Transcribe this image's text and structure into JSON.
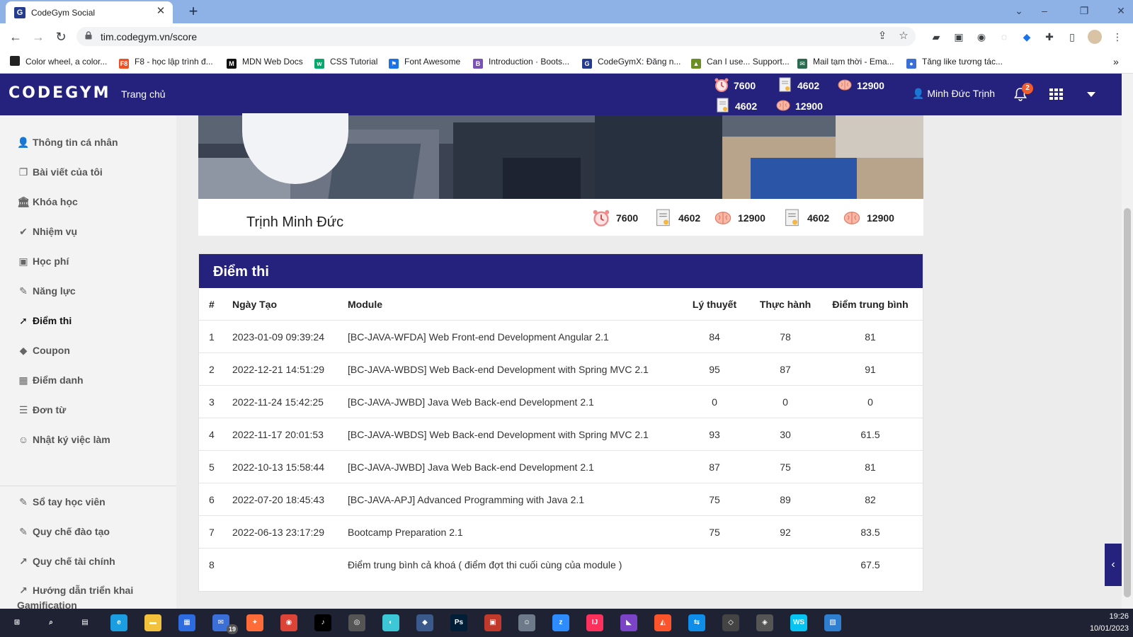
{
  "browser": {
    "tab_title": "CodeGym Social",
    "tab_favicon": "G",
    "url": "tim.codegym.vn/score",
    "bookmarks": [
      {
        "label": "Color wheel, a color...",
        "icon": "color-wheel-icon",
        "color": "#222222"
      },
      {
        "label": "F8 - học lập trình đ...",
        "icon": "f8-icon",
        "color": "#f05123"
      },
      {
        "label": "MDN Web Docs",
        "icon": "mdn-icon",
        "color": "#111111"
      },
      {
        "label": "CSS Tutorial",
        "icon": "w3schools-icon",
        "color": "#04aa6d"
      },
      {
        "label": "Font Awesome",
        "icon": "flag-icon",
        "color": "#1a73e8"
      },
      {
        "label": "Introduction · Boots...",
        "icon": "bootstrap-icon",
        "color": "#7952b3"
      },
      {
        "label": "CodeGymX: Đăng n...",
        "icon": "codegym-icon",
        "color": "#243b8e"
      },
      {
        "label": "Can I use... Support...",
        "icon": "caniuse-icon",
        "color": "#6b8e23"
      },
      {
        "label": "Mail tạm thời - Ema...",
        "icon": "mail-icon",
        "color": "#2a6b4f"
      },
      {
        "label": "Tăng like tương tác...",
        "icon": "like-icon",
        "color": "#3b6fd8"
      }
    ]
  },
  "header": {
    "logo": "CODEGYM",
    "home": "Trang chủ",
    "stats_row1": [
      "7600",
      "4602",
      "12900"
    ],
    "stats_row2": [
      "4602",
      "12900"
    ],
    "user": "Minh Đức Trịnh",
    "notification_count": "2"
  },
  "sidebar": {
    "items": [
      {
        "label": "Thông tin cá nhân",
        "icon": "user-icon",
        "glyph": "👤"
      },
      {
        "label": "Bài viết của tôi",
        "icon": "copy-icon",
        "glyph": "❐"
      },
      {
        "label": "Khóa học",
        "icon": "institution-icon",
        "glyph": "🏛"
      },
      {
        "label": "Nhiệm vụ",
        "icon": "check-icon",
        "glyph": "✔"
      },
      {
        "label": "Học phí",
        "icon": "money-icon",
        "glyph": "▣"
      },
      {
        "label": "Năng lực",
        "icon": "magic-wand-icon",
        "glyph": "✎"
      },
      {
        "label": "Điểm thi",
        "icon": "rocket-icon",
        "glyph": "➚"
      },
      {
        "label": "Coupon",
        "icon": "tag-icon",
        "glyph": "◆"
      },
      {
        "label": "Điểm danh",
        "icon": "calendar-icon",
        "glyph": "▦"
      },
      {
        "label": "Đơn từ",
        "icon": "file-icon",
        "glyph": "☰"
      },
      {
        "label": "Nhật ký việc làm",
        "icon": "handshake-icon",
        "glyph": "☺"
      },
      {
        "label": "Sổ tay học viên",
        "icon": "book-icon",
        "glyph": "✎"
      },
      {
        "label": "Quy chế đào tạo",
        "icon": "edit-icon",
        "glyph": "✎"
      },
      {
        "label": "Quy chế tài chính",
        "icon": "chart-icon",
        "glyph": "↗"
      },
      {
        "label": "Hướng dẫn triển khai Gamification",
        "icon": "chart-icon",
        "glyph": "↗"
      }
    ],
    "active_label": "Điểm thi"
  },
  "profile": {
    "name": "Trịnh Minh Đức",
    "stats": [
      "7600",
      "4602",
      "12900",
      "4602",
      "12900"
    ]
  },
  "scores": {
    "title": "Điểm thi",
    "columns": [
      "#",
      "Ngày Tạo",
      "Module",
      "Lý thuyết",
      "Thực hành",
      "Điểm trung bình"
    ],
    "rows": [
      [
        "1",
        "2023-01-09 09:39:24",
        "[BC-JAVA-WFDA] Web Front-end Development Angular 2.1",
        "84",
        "78",
        "81"
      ],
      [
        "2",
        "2022-12-21 14:51:29",
        "[BC-JAVA-WBDS] Web Back-end Development with Spring MVC 2.1",
        "95",
        "87",
        "91"
      ],
      [
        "3",
        "2022-11-24 15:42:25",
        "[BC-JAVA-JWBD] Java Web Back-end Development 2.1",
        "0",
        "0",
        "0"
      ],
      [
        "4",
        "2022-11-17 20:01:53",
        "[BC-JAVA-WBDS] Web Back-end Development with Spring MVC 2.1",
        "93",
        "30",
        "61.5"
      ],
      [
        "5",
        "2022-10-13 15:58:44",
        "[BC-JAVA-JWBD] Java Web Back-end Development 2.1",
        "87",
        "75",
        "81"
      ],
      [
        "6",
        "2022-07-20 18:45:43",
        "[BC-JAVA-APJ] Advanced Programming with Java 2.1",
        "75",
        "89",
        "82"
      ],
      [
        "7",
        "2022-06-13 23:17:29",
        "Bootcamp Preparation 2.1",
        "75",
        "92",
        "83.5"
      ],
      [
        "8",
        "",
        "Điểm trung bình cả khoá ( điểm đợt thi cuối cùng của module )",
        "",
        "",
        "67.5"
      ]
    ]
  },
  "taskbar": {
    "time": "19:26",
    "date": "10/01/2023",
    "mail_badge": "19",
    "apps": [
      {
        "icon": "start-icon",
        "color": "#1f2233"
      },
      {
        "icon": "search-icon",
        "color": "#1f2233"
      },
      {
        "icon": "task-view-icon",
        "color": "#1f2233"
      },
      {
        "icon": "edge-icon",
        "color": "#1b9de2"
      },
      {
        "icon": "file-explorer-icon",
        "color": "#f3c23c"
      },
      {
        "icon": "store-icon",
        "color": "#2d6be0"
      },
      {
        "icon": "mail-app-icon",
        "color": "#3b6fd8"
      },
      {
        "icon": "postman-icon",
        "color": "#ff6c37"
      },
      {
        "icon": "chrome-icon",
        "color": "#db4437"
      },
      {
        "icon": "tiktok-icon",
        "color": "#000000"
      },
      {
        "icon": "openai-icon",
        "color": "#555555"
      },
      {
        "icon": "browser-icon",
        "color": "#3cc7d6"
      },
      {
        "icon": "vpn-icon",
        "color": "#3a5a8c"
      },
      {
        "icon": "photoshop-icon",
        "color": "#001e36"
      },
      {
        "icon": "app-icon",
        "color": "#c0392b"
      },
      {
        "icon": "robot-icon",
        "color": "#6c7a89"
      },
      {
        "icon": "zoom-icon",
        "color": "#2d8cff"
      },
      {
        "icon": "intellij-icon",
        "color": "#fe315d"
      },
      {
        "icon": "visual-studio-icon",
        "color": "#7b44c6"
      },
      {
        "icon": "brave-icon",
        "color": "#fb542b"
      },
      {
        "icon": "teamviewer-icon",
        "color": "#0e8ee9"
      },
      {
        "icon": "unity-icon",
        "color": "#444444"
      },
      {
        "icon": "unity-hub-icon",
        "color": "#555555"
      },
      {
        "icon": "webstorm-icon",
        "color": "#07c3f2"
      },
      {
        "icon": "photos-icon",
        "color": "#2f7fd1"
      }
    ]
  }
}
